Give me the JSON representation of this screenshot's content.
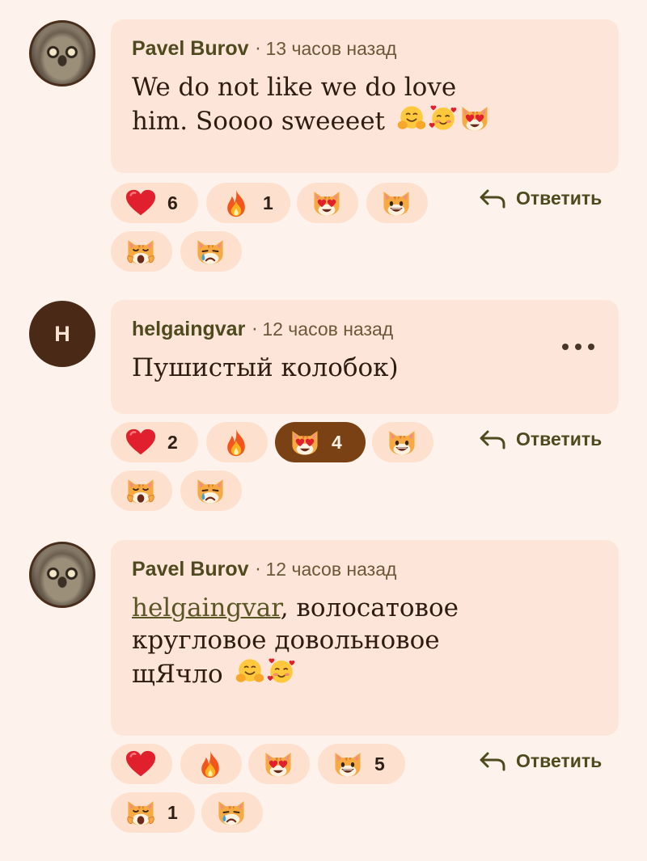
{
  "reply_label": "Ответить",
  "colors": {
    "bubble": "#fde6d9",
    "pill": "#fde0cd",
    "pill_active": "#7a4214",
    "author": "#4e4a1e",
    "page": "#fdf3ec"
  },
  "comments": [
    {
      "author": "Pavel Burov",
      "separator": "·",
      "time": "13 часов назад",
      "avatar": {
        "type": "photo",
        "icon": "pallas-cat-avatar"
      },
      "text": "We do not like we do love him. Soooo sweeeet",
      "inline_emojis": [
        "hugging-face",
        "smiling-face-with-hearts",
        "heart-eyes-cat"
      ],
      "reactions": [
        {
          "emoji": "red-heart",
          "count": "6"
        },
        {
          "emoji": "fire",
          "count": "1"
        },
        {
          "emoji": "heart-eyes-cat",
          "count": ""
        },
        {
          "emoji": "grinning-cat",
          "count": ""
        },
        {
          "emoji": "weary-cat",
          "count": ""
        },
        {
          "emoji": "crying-cat",
          "count": ""
        }
      ]
    },
    {
      "author": "helgaingvar",
      "separator": "·",
      "time": "12 часов назад",
      "avatar": {
        "type": "letter",
        "initial": "H"
      },
      "text": "Пушистый колобок)",
      "has_menu": true,
      "reactions": [
        {
          "emoji": "red-heart",
          "count": "2"
        },
        {
          "emoji": "fire",
          "count": ""
        },
        {
          "emoji": "heart-eyes-cat",
          "count": "4",
          "active": true
        },
        {
          "emoji": "grinning-cat",
          "count": ""
        },
        {
          "emoji": "weary-cat",
          "count": ""
        },
        {
          "emoji": "crying-cat",
          "count": ""
        }
      ]
    },
    {
      "author": "Pavel Burov",
      "separator": "·",
      "time": "12 часов назад",
      "avatar": {
        "type": "photo",
        "icon": "pallas-cat-avatar"
      },
      "mention": "helgaingvar",
      "text": ", волосатовое кругловое довольновое щЯчло",
      "inline_emojis": [
        "hugging-face",
        "smiling-face-with-hearts"
      ],
      "reactions": [
        {
          "emoji": "red-heart",
          "count": ""
        },
        {
          "emoji": "fire",
          "count": ""
        },
        {
          "emoji": "heart-eyes-cat",
          "count": ""
        },
        {
          "emoji": "grinning-cat",
          "count": "5"
        },
        {
          "emoji": "weary-cat",
          "count": "1"
        },
        {
          "emoji": "crying-cat",
          "count": ""
        }
      ]
    }
  ]
}
